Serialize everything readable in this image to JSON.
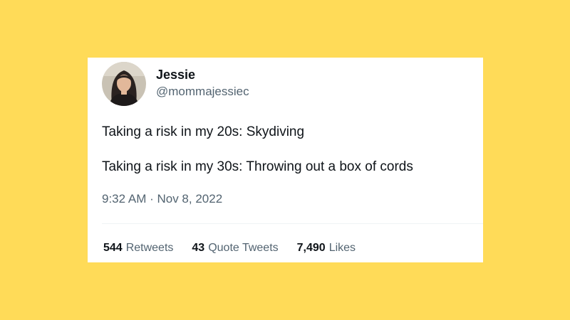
{
  "colors": {
    "background": "#FFDB58",
    "card": "#FFFFFF",
    "text_primary": "#0F1419",
    "text_secondary": "#536471",
    "divider": "#EFF3F4"
  },
  "author": {
    "name": "Jessie",
    "handle": "@mommajessiec",
    "avatar_icon": "profile-photo"
  },
  "tweet": {
    "lines": [
      "Taking a risk in my 20s: Skydiving",
      "Taking a risk in my 30s: Throwing out a box of cords"
    ],
    "timestamp": "9:32 AM · Nov 8, 2022"
  },
  "stats": [
    {
      "count": "544",
      "label": "Retweets"
    },
    {
      "count": "43",
      "label": "Quote Tweets"
    },
    {
      "count": "7,490",
      "label": "Likes"
    }
  ]
}
